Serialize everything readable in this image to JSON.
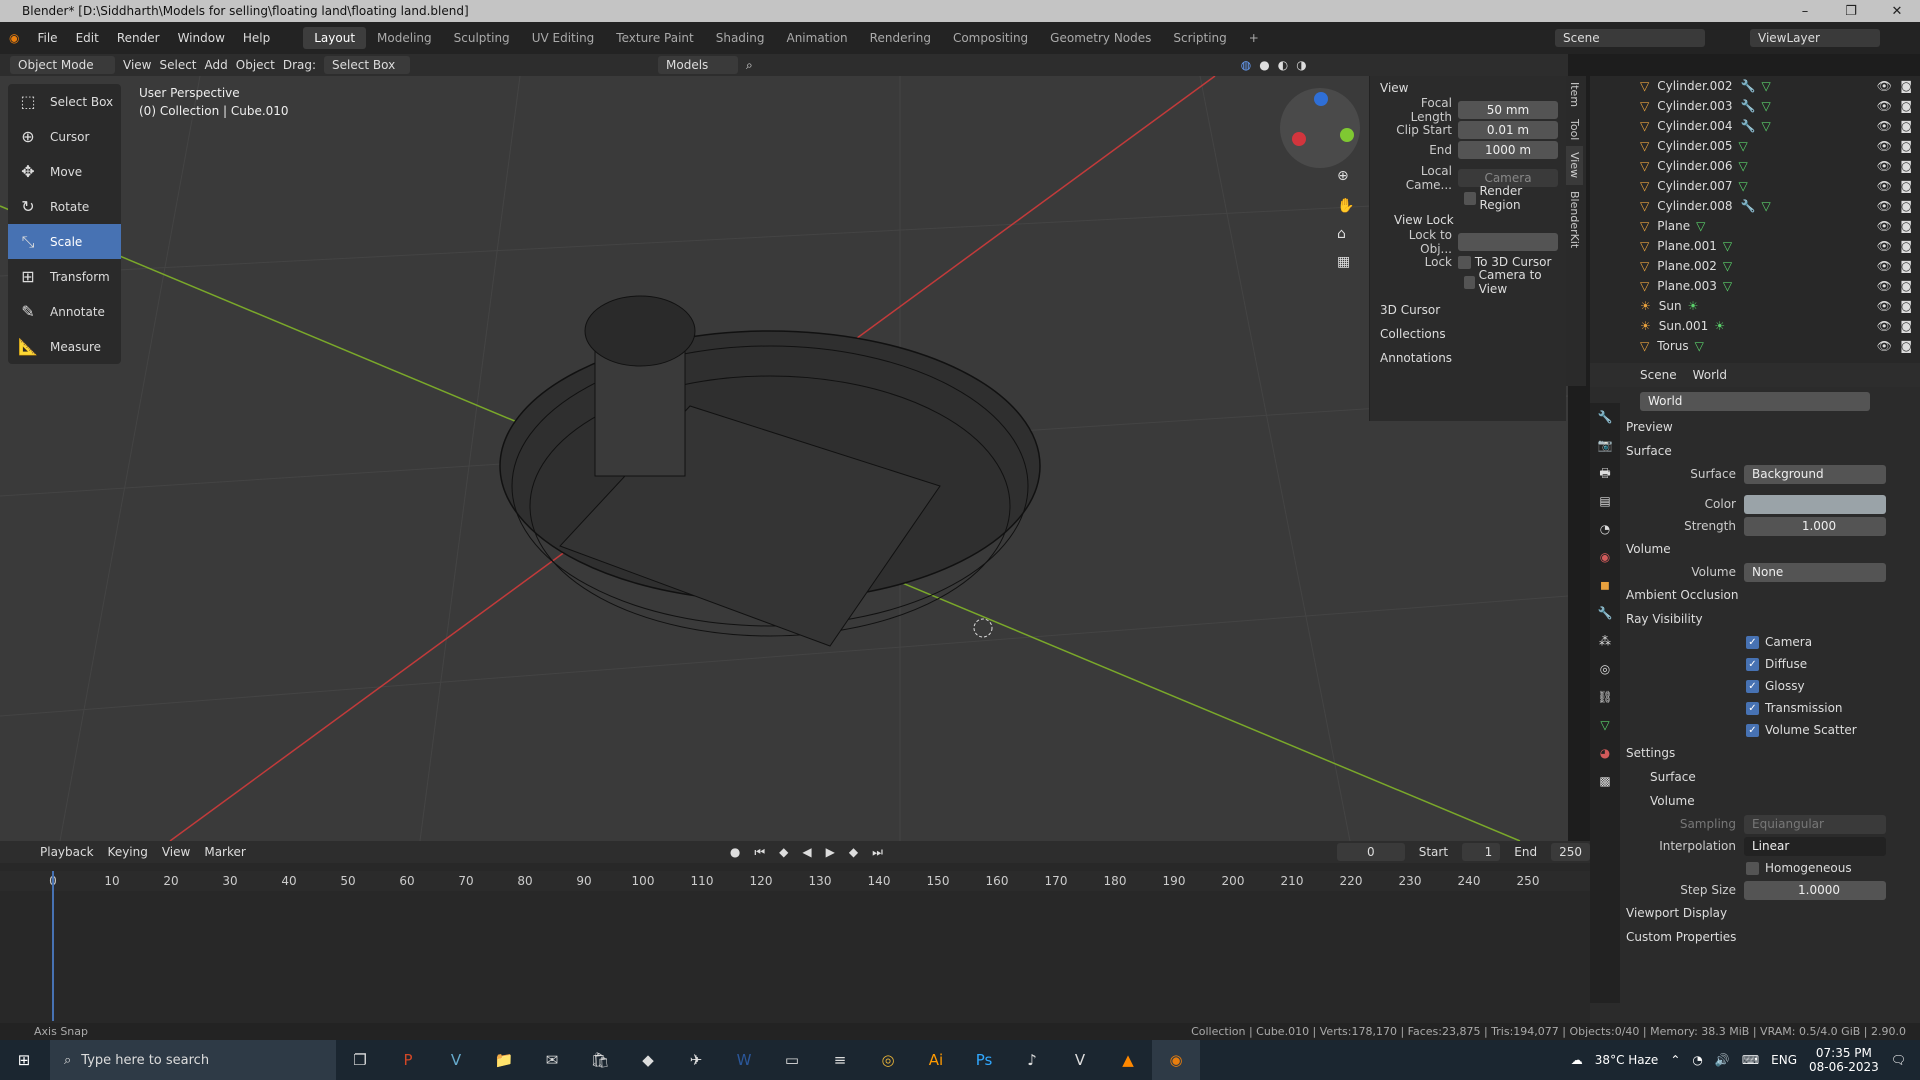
{
  "window": {
    "title": "Blender* [D:\\Siddharth\\Models for selling\\floating land\\floating land.blend]"
  },
  "menu": [
    "File",
    "Edit",
    "Render",
    "Window",
    "Help"
  ],
  "workspaces": [
    "Layout",
    "Modeling",
    "Sculpting",
    "UV Editing",
    "Texture Paint",
    "Shading",
    "Animation",
    "Rendering",
    "Compositing",
    "Geometry Nodes",
    "Scripting"
  ],
  "scene": {
    "name": "Scene",
    "view_layer": "ViewLayer"
  },
  "viewport_header": {
    "mode": "Object Mode",
    "view": "View",
    "select": "Select",
    "add": "Add",
    "object": "Object",
    "drag_label": "Drag:",
    "drag_value": "Select Box",
    "collection": "Models"
  },
  "viewport_info": {
    "perspective": "User Perspective",
    "collection": "(0) Collection | Cube.010"
  },
  "tools": [
    "Select Box",
    "Cursor",
    "Move",
    "Rotate",
    "Scale",
    "Transform",
    "Annotate",
    "Measure"
  ],
  "npanel": {
    "view": "View",
    "focal_label": "Focal Length",
    "focal": "50 mm",
    "clip_start_label": "Clip Start",
    "clip_start": "0.01 m",
    "end_label": "End",
    "end": "1000 m",
    "local_camera": "Local Came...",
    "camera": "Camera",
    "render_region": "Render Region",
    "view_lock": "View Lock",
    "lock_to_obj": "Lock to Obj...",
    "lock": "Lock",
    "to_3d_cursor": "To 3D Cursor",
    "camera_to_view": "Camera to View",
    "cursor3d": "3D Cursor",
    "collections": "Collections",
    "annotations": "Annotations",
    "tabs": [
      "Item",
      "Tool",
      "View",
      "BlenderKit"
    ]
  },
  "outliner": [
    "Cylinder.002",
    "Cylinder.003",
    "Cylinder.004",
    "Cylinder.005",
    "Cylinder.006",
    "Cylinder.007",
    "Cylinder.008",
    "Plane",
    "Plane.001",
    "Plane.002",
    "Plane.003",
    "Sun",
    "Sun.001",
    "Torus"
  ],
  "properties": {
    "scene_tab": "Scene",
    "world_tab": "World",
    "world_name": "World",
    "preview": "Preview",
    "surface_section": "Surface",
    "surface_label": "Surface",
    "surface_value": "Background",
    "color_label": "Color",
    "strength_label": "Strength",
    "strength": "1.000",
    "volume_section": "Volume",
    "volume_label": "Volume",
    "volume_value": "None",
    "ambient_occlusion": "Ambient Occlusion",
    "ray_visibility": "Ray Visibility",
    "camera": "Camera",
    "diffuse": "Diffuse",
    "glossy": "Glossy",
    "transmission": "Transmission",
    "volume_scatter": "Volume Scatter",
    "settings": "Settings",
    "set_surface": "Surface",
    "set_volume": "Volume",
    "sampling_label": "Sampling",
    "sampling": "Equiangular",
    "interpolation_label": "Interpolation",
    "interpolation": "Linear",
    "homogeneous": "Homogeneous",
    "step_size_label": "Step Size",
    "step_size": "1.0000",
    "viewport_display": "Viewport Display",
    "custom_properties": "Custom Properties"
  },
  "timeline": {
    "playback": "Playback",
    "keying": "Keying",
    "view": "View",
    "marker": "Marker",
    "current": "0",
    "start_label": "Start",
    "start": "1",
    "end_label": "End",
    "end": "250",
    "ticks": [
      "0",
      "10",
      "20",
      "30",
      "40",
      "50",
      "60",
      "70",
      "80",
      "90",
      "100",
      "110",
      "120",
      "130",
      "140",
      "150",
      "160",
      "170",
      "180",
      "190",
      "200",
      "210",
      "220",
      "230",
      "240",
      "250"
    ]
  },
  "status": {
    "left": "Axis Snap",
    "right": "Collection | Cube.010 | Verts:178,170 | Faces:23,875 | Tris:194,077 | Objects:0/40 | Memory: 38.3 MiB | VRAM: 0.5/4.0 GiB | 2.90.0"
  },
  "taskbar": {
    "search": "Type here to search",
    "weather": "38°C  Haze",
    "lang": "ENG",
    "time": "07:35 PM",
    "date": "08-06-2023"
  }
}
